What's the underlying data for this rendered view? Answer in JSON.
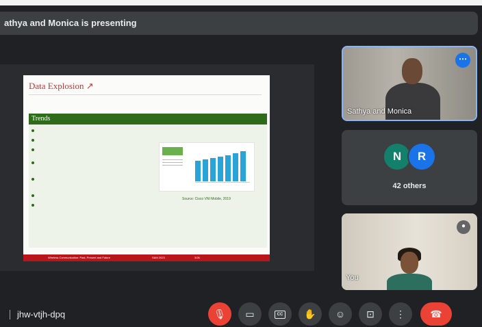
{
  "presenting_banner": "athya and Monica is presenting",
  "slide": {
    "title": "Data Explosion",
    "title_icon": "arrow-up-right-icon",
    "section_heading": "Trends",
    "source": "Source: Cisco VNI Mobile, 2019",
    "footer_left": "Wireless Communication: Past, Present and Future",
    "footer_mid": "SAM 2023",
    "footer_right": "3/26"
  },
  "participants": {
    "presenter_name": "Sathya and Monica",
    "avatar_1": "N",
    "avatar_2": "R",
    "others_count": "42 others",
    "self_name": "You"
  },
  "meeting_code": "jhw-vtjh-dpq",
  "controls": {
    "mic": {
      "icon": "mic-off-icon",
      "glyph": "🎙"
    },
    "camera": {
      "icon": "camera-icon",
      "glyph": "▭"
    },
    "captions": {
      "icon": "captions-icon",
      "glyph": "CC"
    },
    "hand": {
      "icon": "raise-hand-icon",
      "glyph": "✋"
    },
    "emoji": {
      "icon": "emoji-icon",
      "glyph": "☺"
    },
    "present": {
      "icon": "present-icon",
      "glyph": "⊡"
    },
    "more": {
      "icon": "more-vert-icon",
      "glyph": "⋮"
    },
    "hangup": {
      "icon": "hangup-icon",
      "glyph": "☎"
    }
  },
  "colors": {
    "accent_blue": "#1a73e8",
    "danger_red": "#ea4335",
    "slide_green": "#2e6b1a",
    "slide_red": "#b8161b"
  }
}
